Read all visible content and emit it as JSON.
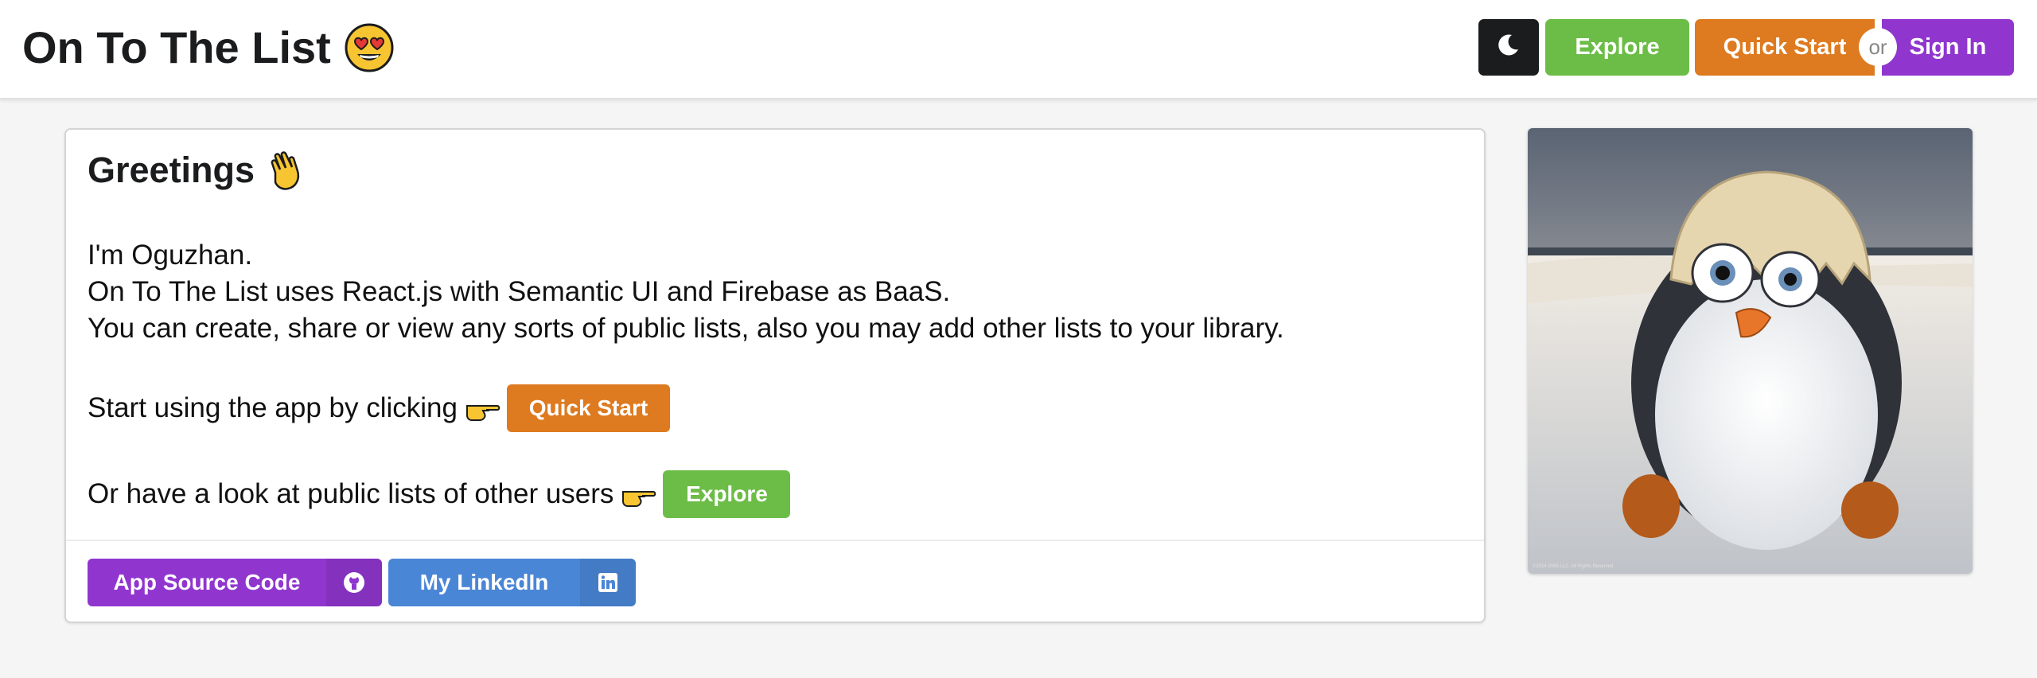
{
  "header": {
    "title": "On To The List",
    "title_emoji": "heart-eyes-emoji",
    "theme_toggle_icon": "moon-icon",
    "explore_label": "Explore",
    "quick_start_label": "Quick Start",
    "or_label": "or",
    "sign_in_label": "Sign In"
  },
  "card": {
    "heading": "Greetings",
    "heading_emoji": "waving-hand-emoji",
    "intro_lines": [
      "I'm Oguzhan.",
      "On To The List uses React.js with Semantic UI and Firebase as BaaS.",
      "You can create, share or view any sorts of public lists, also you may add other lists to your library."
    ],
    "quick_start_prompt": "Start using the app by clicking",
    "quick_start_button": "Quick Start",
    "explore_prompt": "Or have a look at public lists of other users",
    "explore_button": "Explore",
    "source_button": "App Source Code",
    "source_icon": "github-icon",
    "linkedin_button": "My LinkedIn",
    "linkedin_icon": "linkedin-icon"
  },
  "image": {
    "subject": "penguin-chick-in-eggshell",
    "caption_text": "©2014 DWA LLC. All Rights Reserved."
  },
  "colors": {
    "explore": "#6cbd47",
    "quick_start": "#de7a1f",
    "sign_in": "#9036cf",
    "linkedin": "#4a86d6",
    "dark": "#1b1c1d"
  }
}
